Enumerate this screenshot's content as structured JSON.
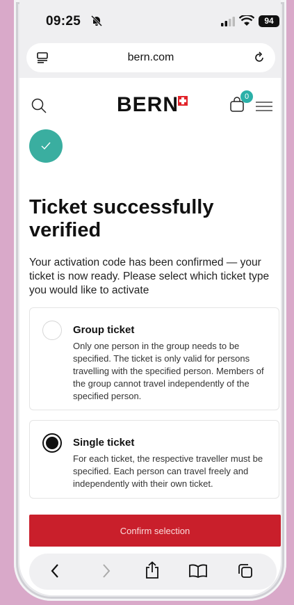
{
  "status_bar": {
    "time": "09:25",
    "battery": "94"
  },
  "browser": {
    "url": "bern.com"
  },
  "header": {
    "logo": "BERN",
    "cart_count": "0"
  },
  "main": {
    "title": "Ticket successfully verified",
    "description": "Your activation code has been confirmed — your ticket is now ready. Please select which ticket type you would like to activate",
    "options": [
      {
        "label": "Group ticket",
        "description": "Only one person in the group needs to be specified. The ticket is only valid for persons travelling with the specified person. Members of the group cannot travel independently of the specified person.",
        "selected": false
      },
      {
        "label": "Single ticket",
        "description": "For each ticket, the respective traveller must be specified. Each person can travel freely and independently with their own ticket.",
        "selected": true
      }
    ],
    "confirm_label": "Confirm selection"
  },
  "icons": {
    "check": "check-icon",
    "search": "search-icon",
    "bag": "shopping-bag-icon",
    "menu": "hamburger-menu-icon"
  },
  "colors": {
    "accent": "#3aaea0",
    "brand_red": "#c91f2b",
    "badge": "#2bb0a8"
  }
}
